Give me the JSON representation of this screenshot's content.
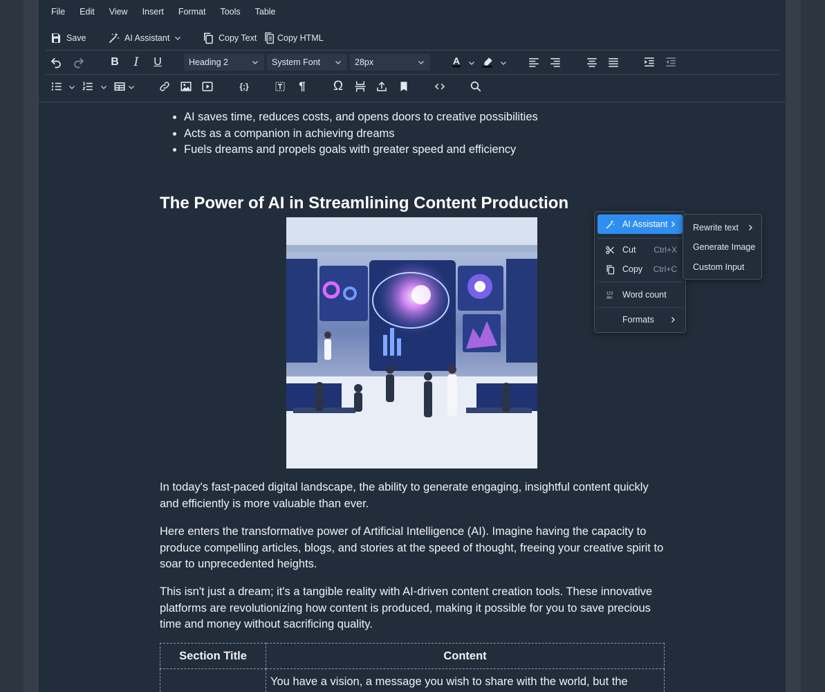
{
  "menu": [
    "File",
    "Edit",
    "View",
    "Insert",
    "Format",
    "Tools",
    "Table"
  ],
  "toolbar": {
    "save": "Save",
    "ai_assistant": "AI Assistant",
    "copy_text": "Copy Text",
    "copy_html": "Copy HTML",
    "block_format": "Heading 2",
    "font_family": "System Font",
    "font_size": "28px"
  },
  "doc": {
    "bullets": [
      "AI saves time, reduces costs, and opens doors to creative possibilities",
      "Acts as a companion in achieving dreams",
      "Fuels dreams and propels goals with greater speed and efficiency"
    ],
    "heading": "The Power of AI in Streamlining Content Production",
    "paragraphs": [
      "In today's fast-paced digital landscape, the ability to generate engaging, insightful content quickly and efficiently is more valuable than ever.",
      "Here enters the transformative power of Artificial Intelligence (AI). Imagine having the capacity to produce compelling articles, blogs, and stories at the speed of thought, freeing your creative spirit to soar to unprecedented heights.",
      "This isn't just a dream; it's a tangible reality with AI-driven content creation tools. These innovative platforms are revolutionizing how content is produced, making it possible for you to save precious time and money without sacrificing quality."
    ],
    "table": {
      "headers": [
        "Section Title",
        "Content"
      ],
      "rows": [
        [
          "",
          "You have a vision, a message you wish to share with the world, but the"
        ]
      ]
    }
  },
  "context_menu": {
    "ai_assistant": "AI Assistant",
    "cut": "Cut",
    "cut_shortcut": "Ctrl+X",
    "copy": "Copy",
    "copy_shortcut": "Ctrl+C",
    "word_count": "Word count",
    "formats": "Formats"
  },
  "submenu": [
    "Rewrite text",
    "Generate Image",
    "Custom Input"
  ],
  "colors": {
    "background": "#222d3b",
    "accent": "#2f8ff0",
    "gutter": "#2d3540"
  }
}
